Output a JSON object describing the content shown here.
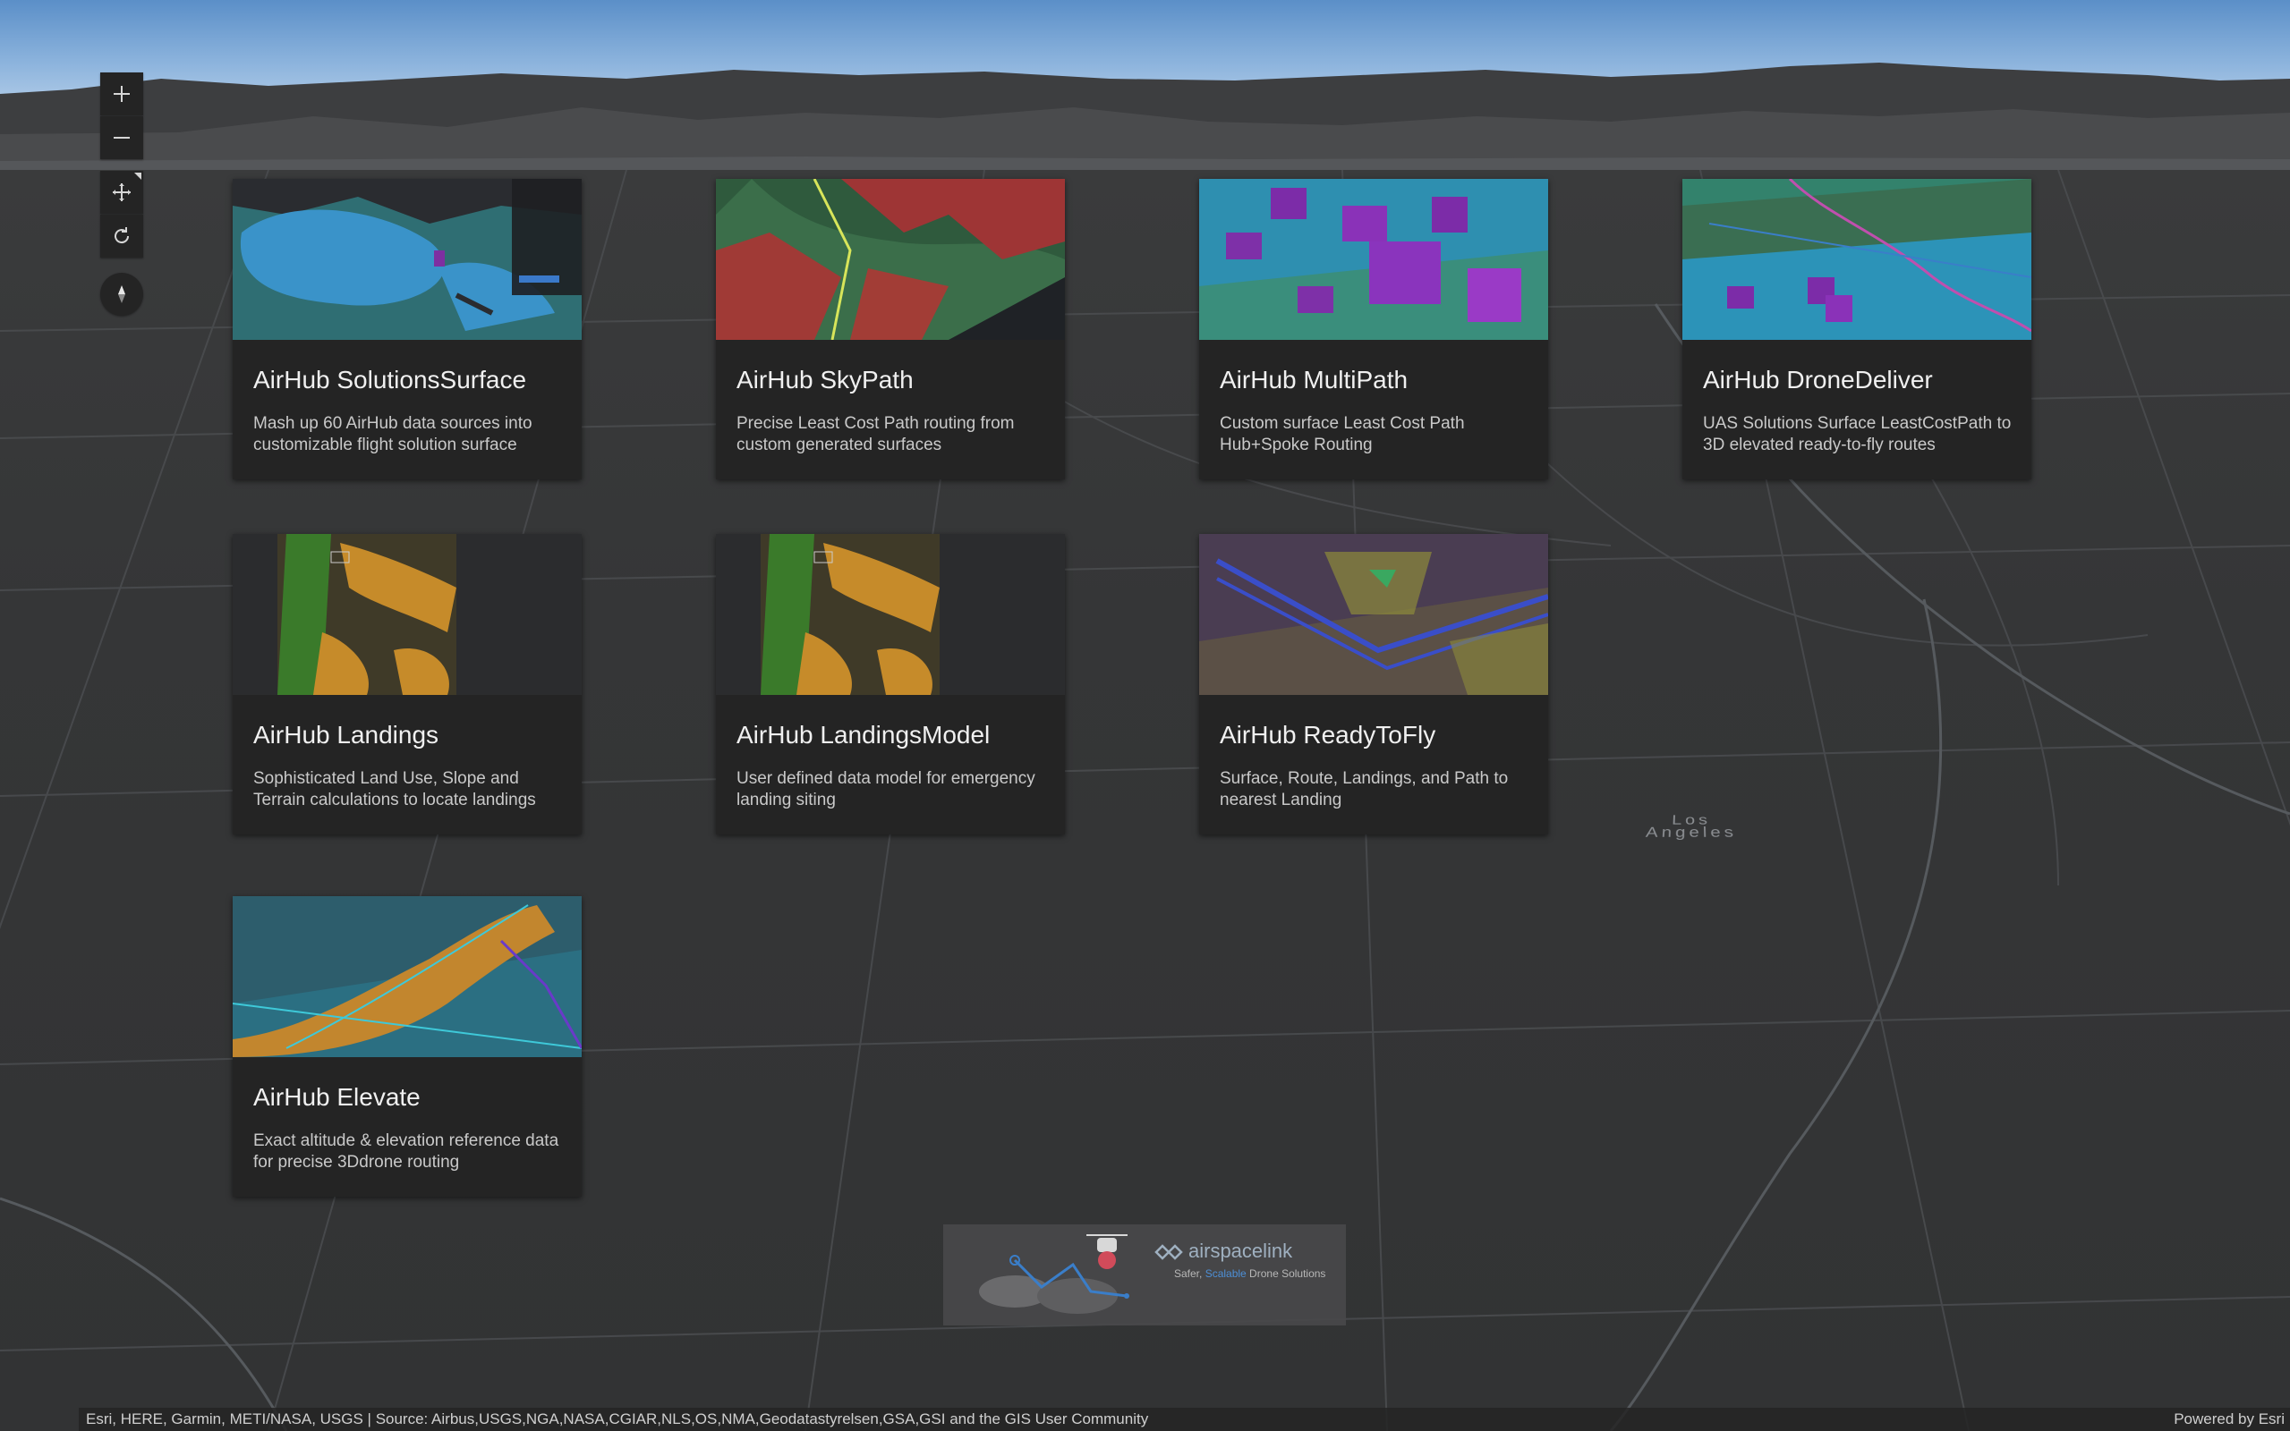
{
  "navigation": {
    "zoom_in_icon": "plus-icon",
    "zoom_out_icon": "minus-icon",
    "pan_icon": "move-icon",
    "rotate_icon": "rotate-icon",
    "compass_icon": "compass-icon"
  },
  "map": {
    "labels": [
      "Los",
      "Angeles"
    ]
  },
  "cards": [
    {
      "title": "AirHub SolutionsSurface",
      "description": "Mash up 60 AirHub data sources into customizable flight solution surface"
    },
    {
      "title": "AirHub SkyPath",
      "description": "Precise Least Cost Path routing from custom generated surfaces"
    },
    {
      "title": "AirHub MultiPath",
      "description": "Custom surface Least Cost Path Hub+Spoke Routing"
    },
    {
      "title": "AirHub DroneDeliver",
      "description": "UAS Solutions Surface LeastCostPath to 3D elevated ready-to-fly routes"
    },
    {
      "title": "AirHub Landings",
      "description": "Sophisticated Land Use, Slope and Terrain calculations to locate landings"
    },
    {
      "title": "AirHub LandingsModel",
      "description": "User defined data model for emergency landing siting"
    },
    {
      "title": "AirHub ReadyToFly",
      "description": "Surface, Route, Landings, and Path to nearest Landing"
    },
    {
      "title": "AirHub Elevate",
      "description": "Exact altitude & elevation reference data for precise 3Ddrone routing"
    }
  ],
  "logo": {
    "name": "airspacelink",
    "tagline_prefix": "Safer, ",
    "tagline_accent": "Scalable",
    "tagline_suffix": " Drone Solutions"
  },
  "attribution": {
    "text": "Esri, HERE, Garmin, METI/NASA, USGS | Source: Airbus,USGS,NGA,NASA,CGIAR,NLS,OS,NMA,Geodatastyrelsen,GSA,GSI and the GIS User Community",
    "powered_by": "Powered by Esri"
  },
  "colors": {
    "card_background": "#242424",
    "accent_blue": "#4d8fd6"
  }
}
